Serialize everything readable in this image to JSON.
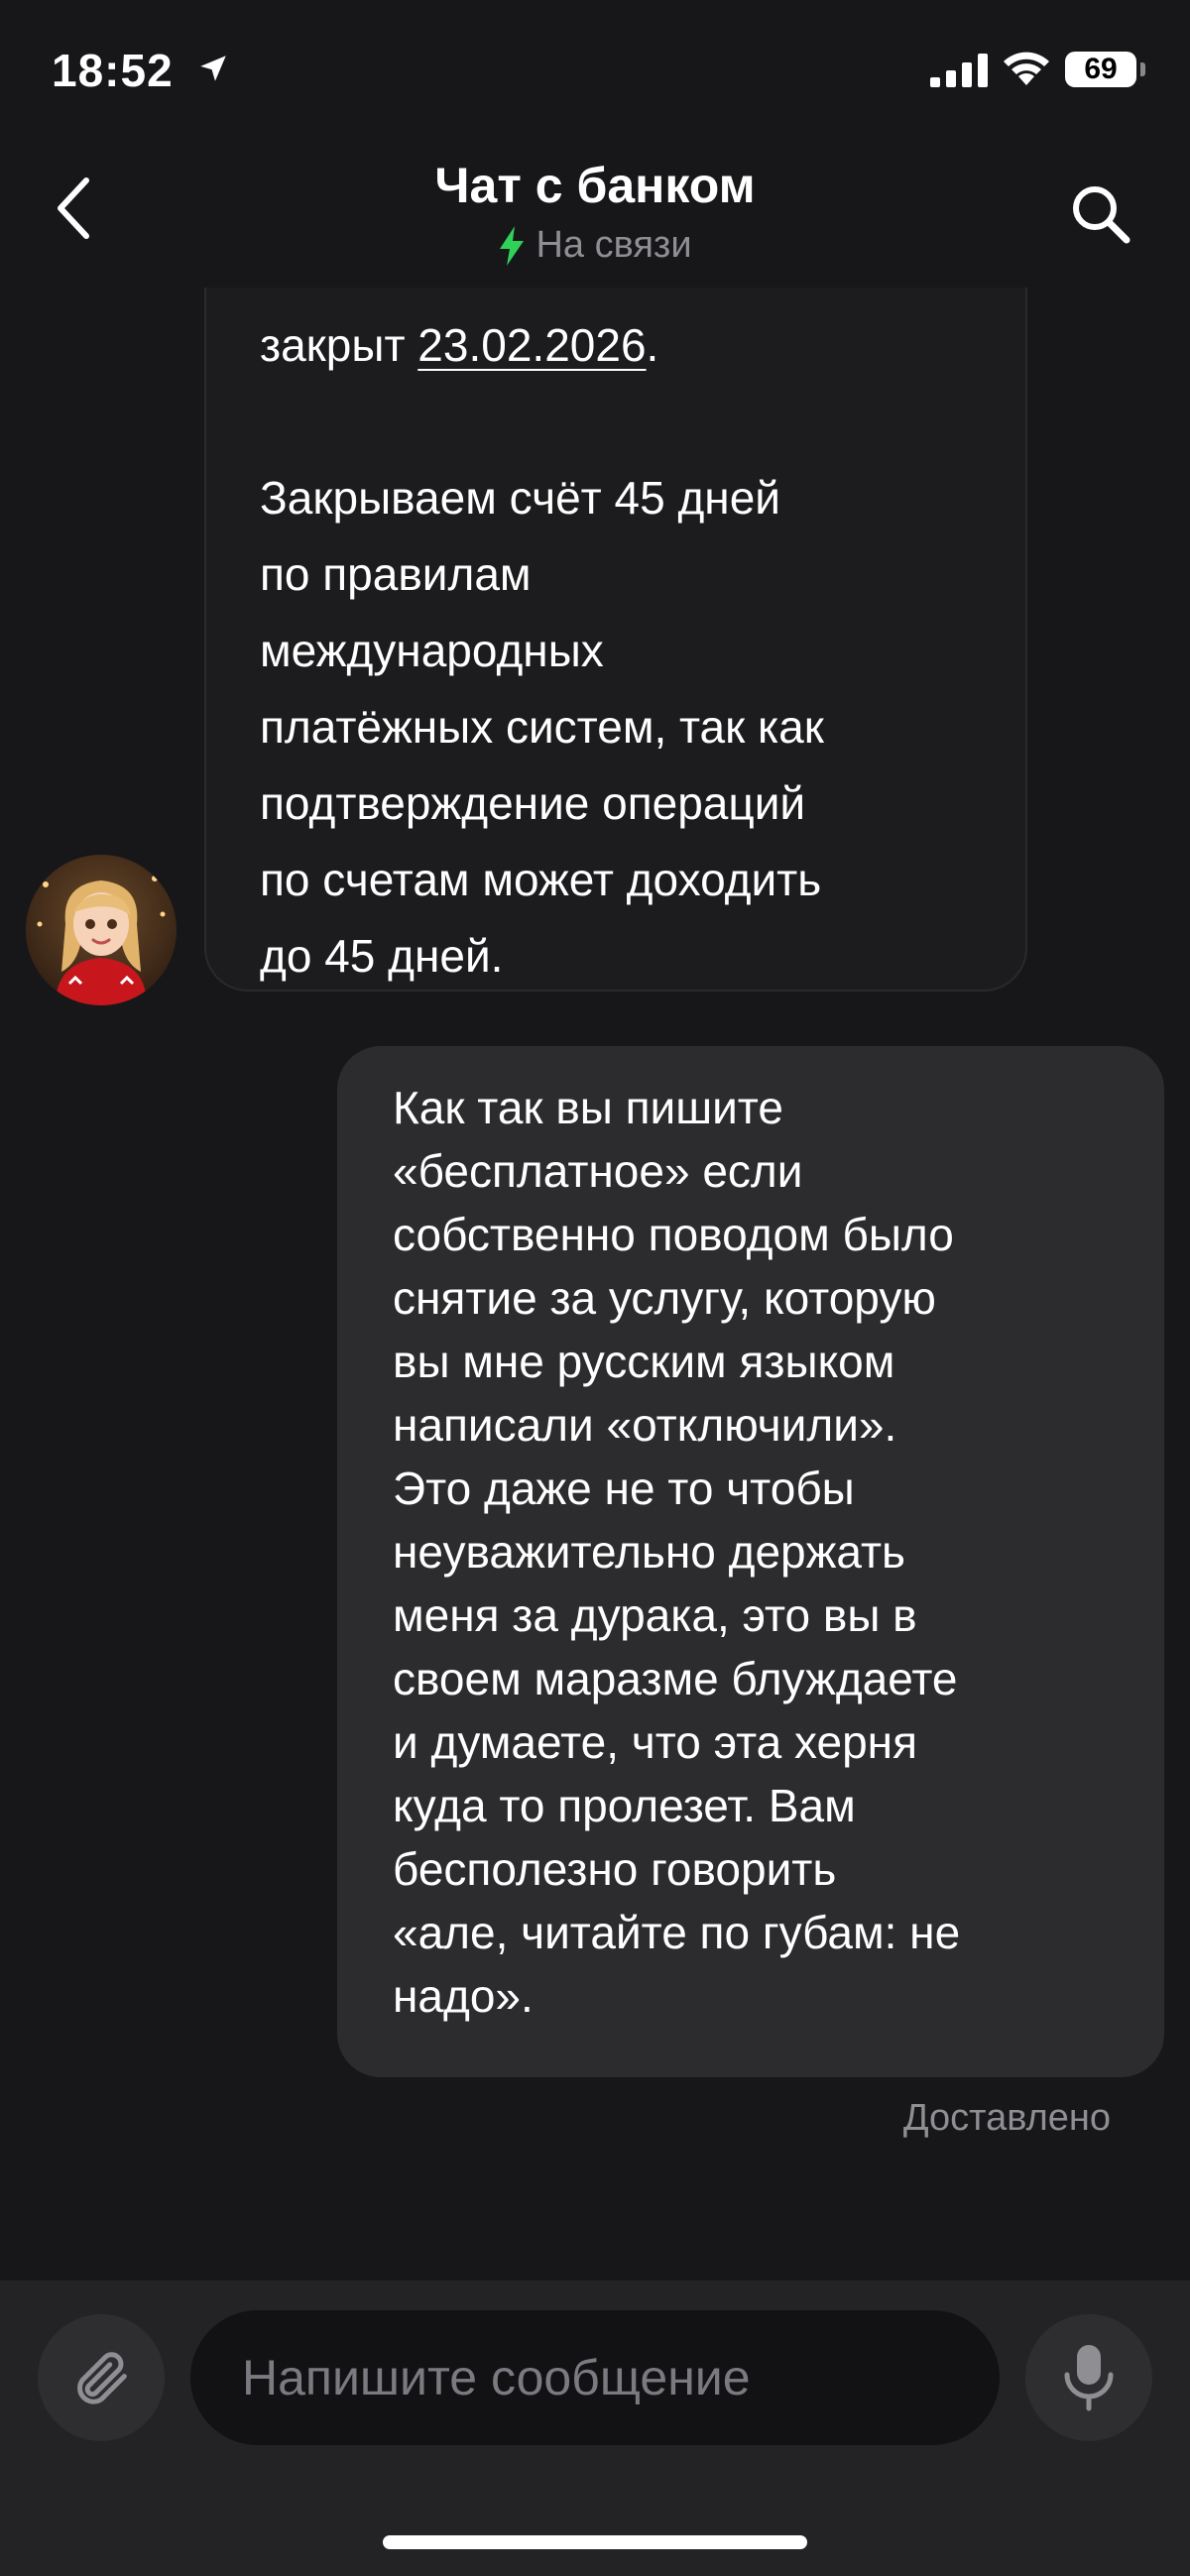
{
  "status": {
    "time": "18:52",
    "battery": "69",
    "location_icon": "location-arrow-icon",
    "signal_icon": "cellular-signal-icon",
    "wifi_icon": "wifi-icon"
  },
  "header": {
    "title": "Чат с банком",
    "status_text": "На связи",
    "status_color": "#30d158",
    "back_icon": "chevron-left-icon",
    "search_icon": "search-icon"
  },
  "messages": {
    "bot": {
      "prefix": "закрыт ",
      "date": "23.02.2026",
      "suffix": ".",
      "body": "Закрываем счёт 45 дней\nпо правилам\nмеждународных\nплатёжных систем, так как\nподтверждение операций\nпо счетам может доходить\nдо 45 дней."
    },
    "user": {
      "lines": [
        "Как так вы пишите",
        "«бесплатное» если",
        "собственно поводом было",
        "снятие за услугу, которую",
        "вы мне русским языком",
        "написали «отключили».",
        "Это даже не то чтобы",
        "неуважительно держать",
        "меня за дурака, это вы в",
        "своем маразме блуждаете",
        "и думаете, что эта херня",
        "куда то пролезет. Вам",
        "бесполезно говорить",
        "«але, читайте по губам: не",
        "надо»."
      ],
      "status": "Доставлено"
    }
  },
  "composer": {
    "placeholder": "Напишите сообщение",
    "attach_icon": "paperclip-icon",
    "mic_icon": "microphone-icon"
  },
  "colors": {
    "background": "#17171a",
    "bot_bubble": "#1c1c1e",
    "user_bubble": "#2c2c2e",
    "muted_text": "#8e8e93"
  }
}
